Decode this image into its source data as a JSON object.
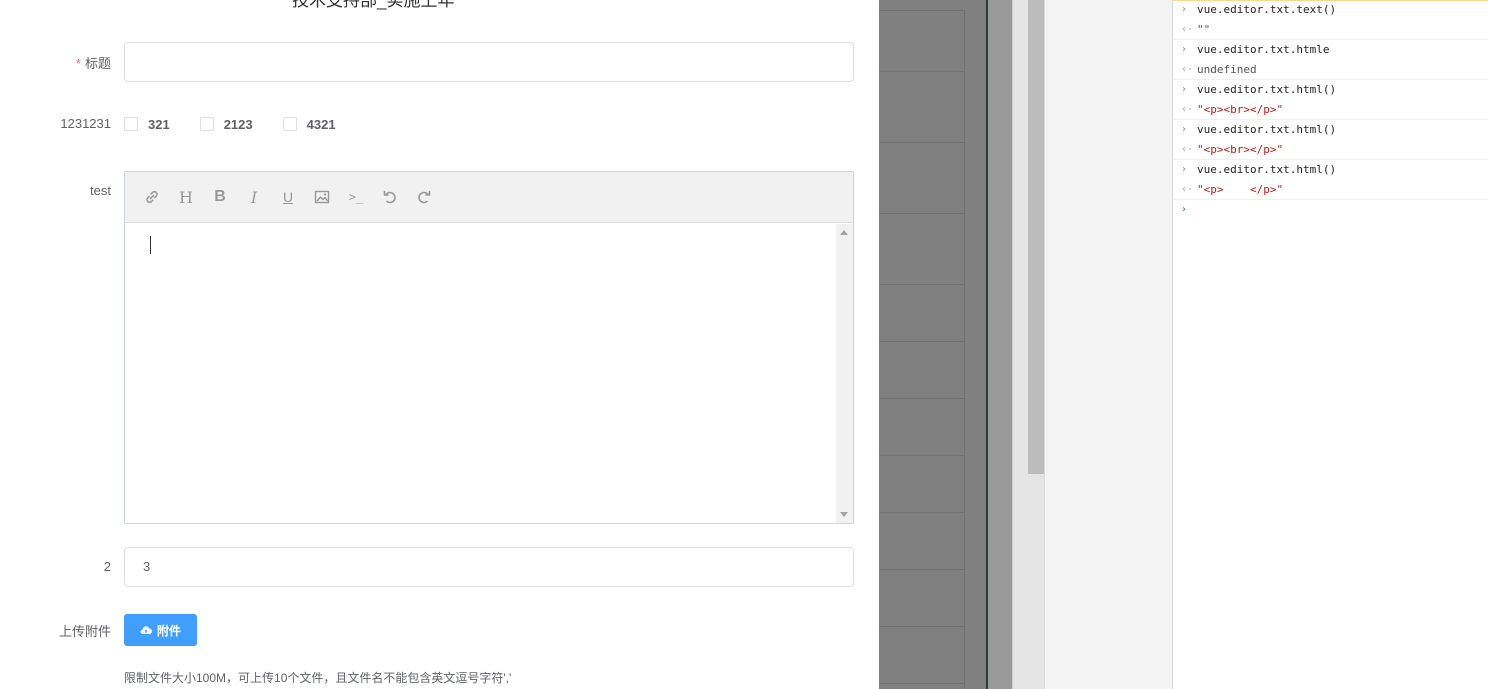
{
  "form": {
    "header_text": "技术支持部_实施上年",
    "title_field": {
      "required_mark": "*",
      "label": "标题",
      "value": ""
    },
    "checkbox_row": {
      "label": "1231231",
      "options": [
        "321",
        "2123",
        "4321"
      ]
    },
    "editor": {
      "label": "test",
      "toolbar": [
        {
          "name": "link-icon",
          "glyph": "link"
        },
        {
          "name": "heading-icon",
          "glyph": "H"
        },
        {
          "name": "bold-icon",
          "glyph": "B"
        },
        {
          "name": "italic-icon",
          "glyph": "I"
        },
        {
          "name": "underline-icon",
          "glyph": "U"
        },
        {
          "name": "image-icon",
          "glyph": "image"
        },
        {
          "name": "code-icon",
          "glyph": ">_"
        },
        {
          "name": "undo-icon",
          "glyph": "undo"
        },
        {
          "name": "redo-icon",
          "glyph": "redo"
        }
      ],
      "content": ""
    },
    "field_2": {
      "label": "2",
      "value": "3"
    },
    "upload": {
      "label": "上传附件",
      "button_label": "附件",
      "hint": "限制文件大小100M，可上传10个文件，且文件名不能包含英文逗号字符','"
    }
  },
  "console": {
    "entries": [
      {
        "input": "vue.editor.txt.text()",
        "output": "\"\""
      },
      {
        "input": "vue.editor.txt.htmle",
        "output": "undefined"
      },
      {
        "input": "vue.editor.txt.html()",
        "output": "\"<p><br></p>\""
      },
      {
        "input": "vue.editor.txt.html()",
        "output": "\"<p><br></p>\""
      },
      {
        "input": "vue.editor.txt.html()",
        "output": "\"<p>    </p>\""
      }
    ],
    "input_glyph": "›",
    "output_glyph": "‹·",
    "prompt_glyph": "›"
  },
  "colors": {
    "primary": "#409eff",
    "required": "#f56c6c",
    "console_string": "#c41a16",
    "overlay": "#808080"
  }
}
